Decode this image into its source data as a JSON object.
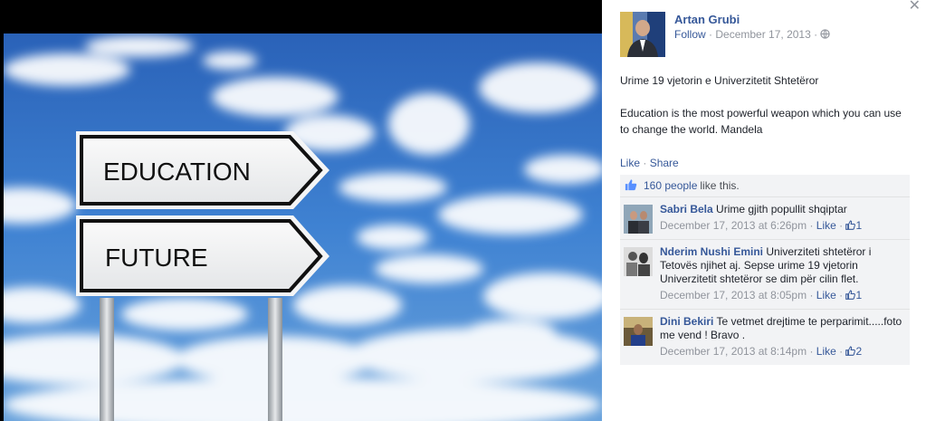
{
  "post": {
    "author": "Artan Grubi",
    "follow": "Follow",
    "date": "December 17, 2013",
    "text_line1": "Urime 19 vjetorin e Univerzitetit Shtetëror",
    "text_line2": "Education is the most powerful weapon which you can use to change the world. Mandela",
    "like_label": "Like",
    "share_label": "Share",
    "likes_count": "160 people",
    "likes_suffix": "like this."
  },
  "photo": {
    "sign_top": "EDUCATION",
    "sign_bottom": "FUTURE"
  },
  "comments": [
    {
      "name": "Sabri Bela",
      "text": "Urime gjith popullit shqiptar",
      "time": "December 17, 2013 at 6:26pm",
      "like": "Like",
      "likes": "1"
    },
    {
      "name": "Nderim Nushi Emini",
      "text": "Univerziteti shtetëror i Tetovës njihet aj. Sepse urime 19 vjetorin Univerzitetit shtetëror se dim për cilin flet.",
      "time": "December 17, 2013 at 8:05pm",
      "like": "Like",
      "likes": "1"
    },
    {
      "name": "Dini Bekiri",
      "text": "Te vetmet drejtime te perparimit.....foto me vend ! Bravo .",
      "time": "December 17, 2013 at 8:14pm",
      "like": "Like",
      "likes": "2"
    }
  ],
  "icons": {
    "close": "close-icon",
    "globe": "globe-icon",
    "thumb": "thumbs-up-icon"
  },
  "colors": {
    "link": "#365899",
    "meta": "#90949c",
    "ufi_bg": "#f2f3f5",
    "sky": "#2f6fc8"
  }
}
